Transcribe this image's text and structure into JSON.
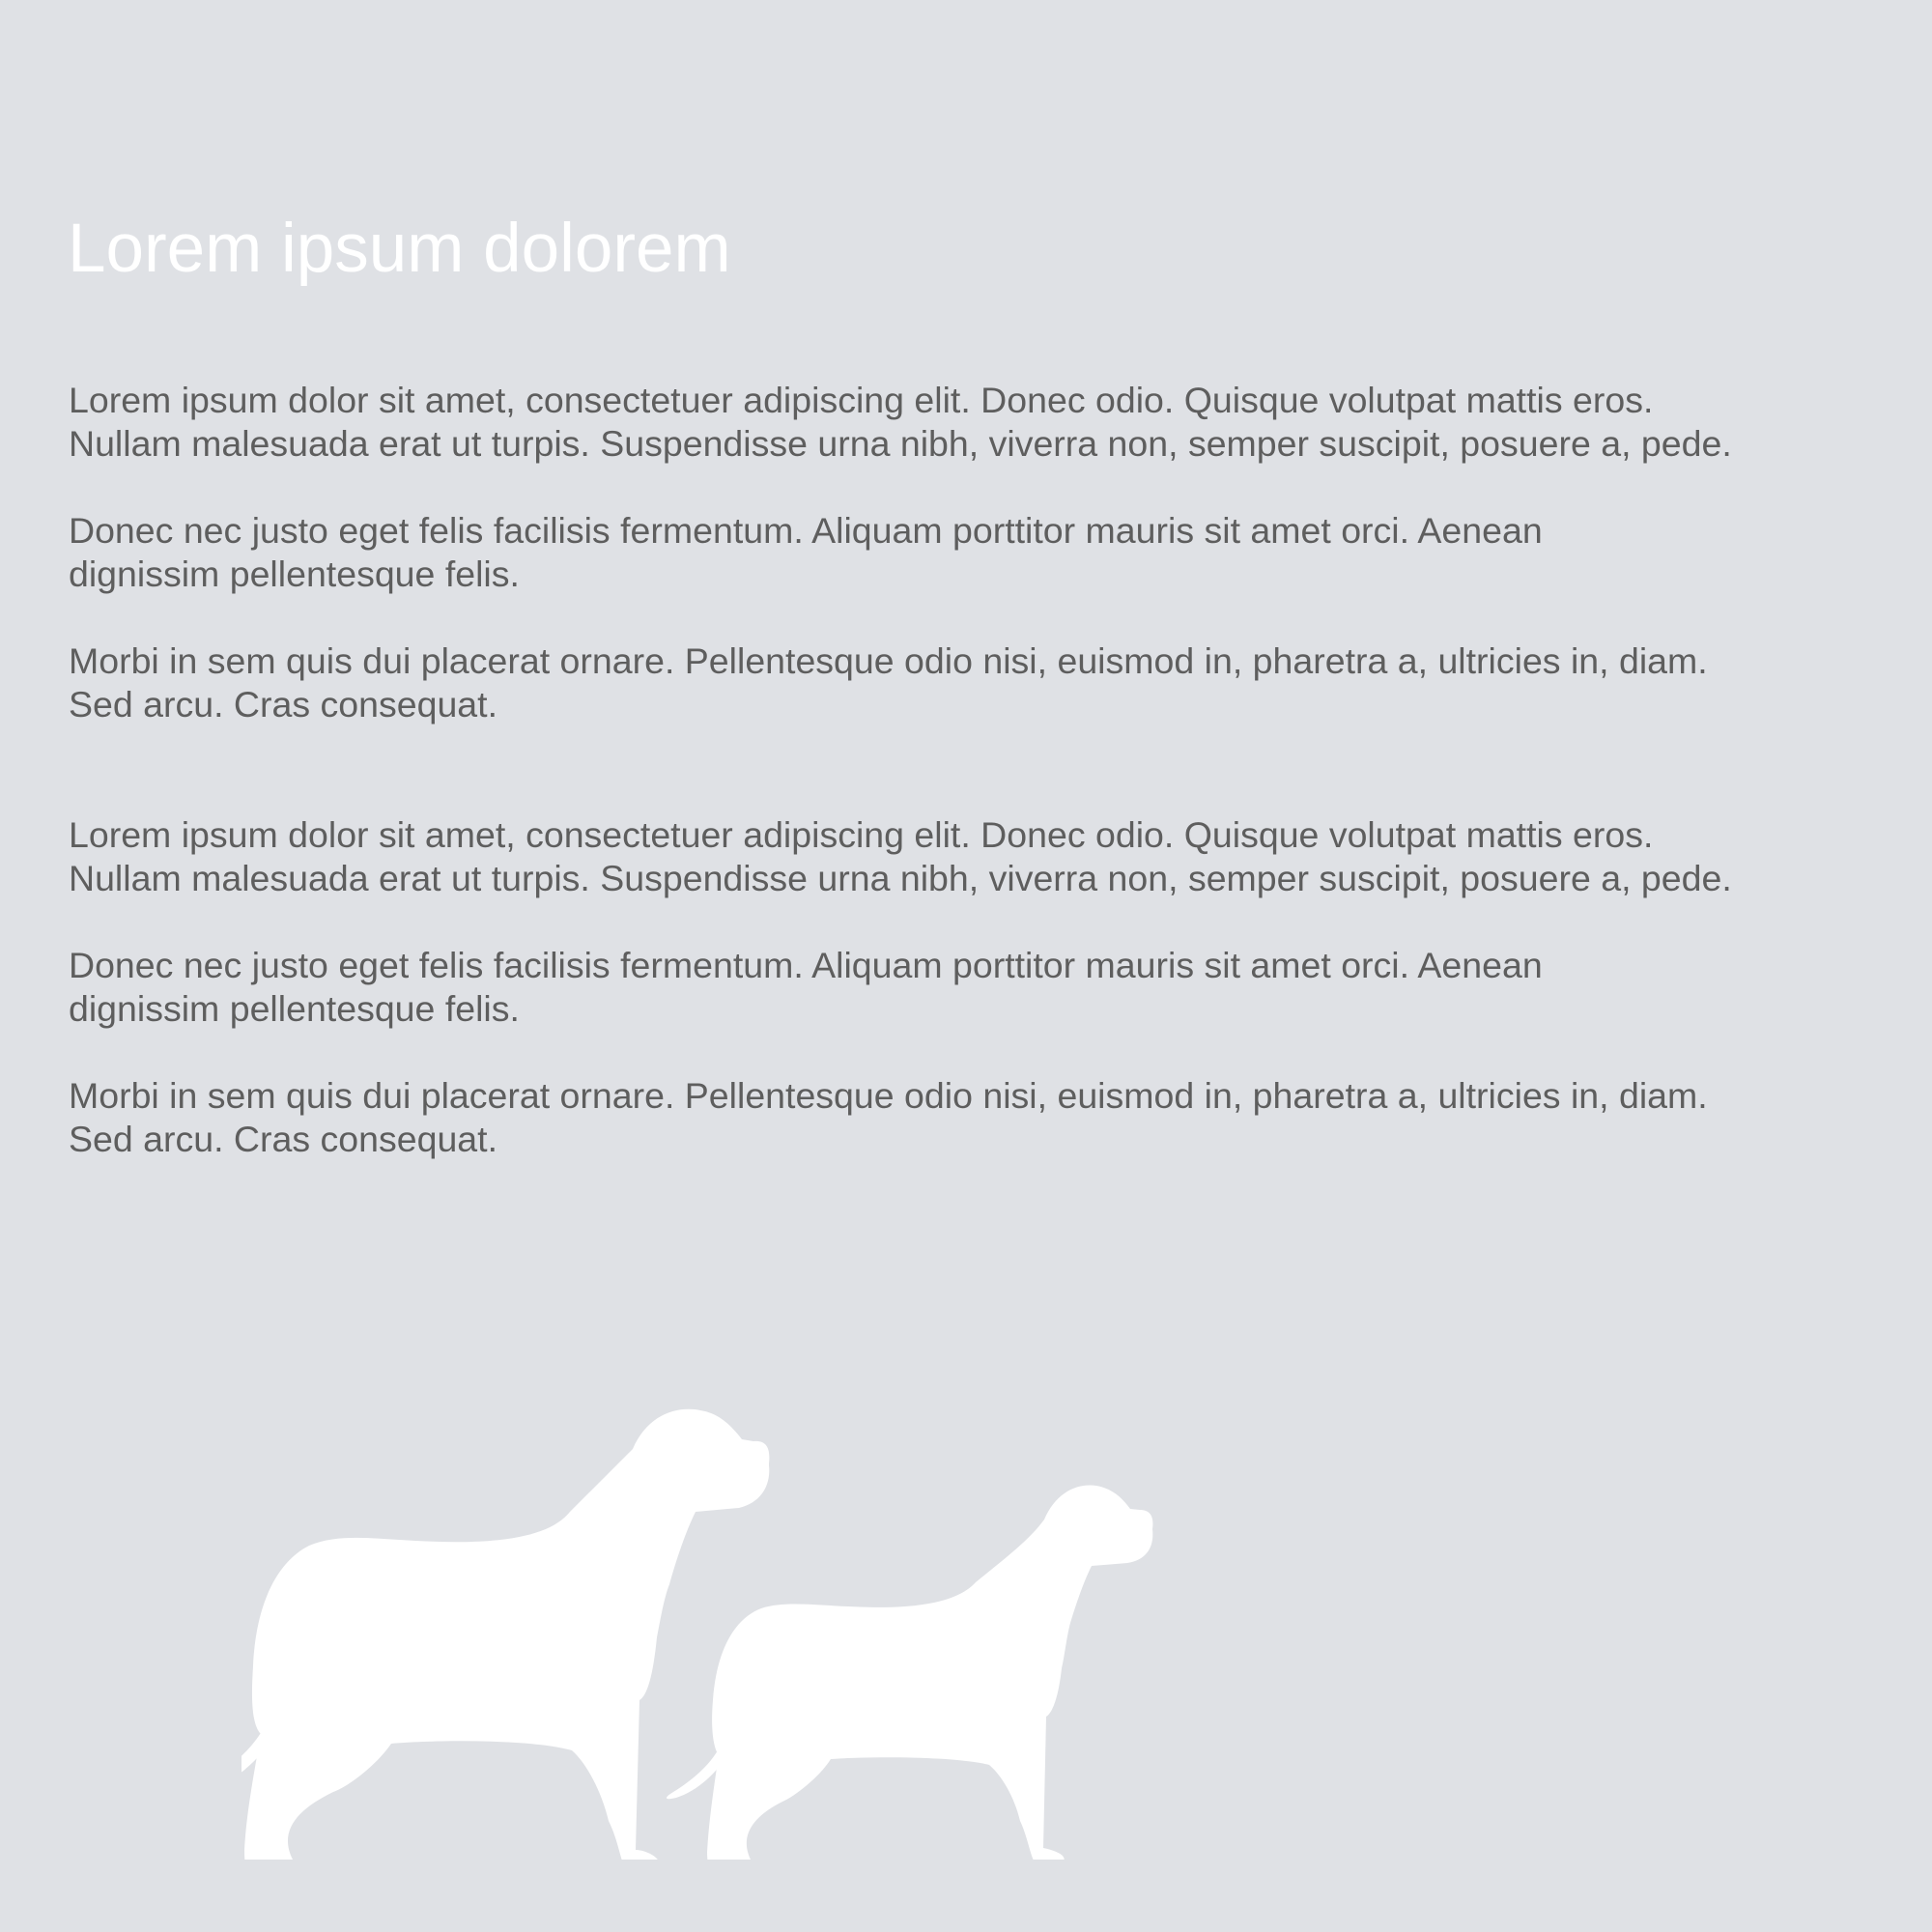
{
  "title": "Lorem ipsum dolorem",
  "sections": [
    {
      "paragraphs": [
        [
          "Lorem ipsum dolor sit amet, consectetuer adipiscing elit. Donec odio. Quisque volutpat mattis eros.",
          "Nullam malesuada erat ut turpis. Suspendisse urna nibh, viverra non, semper suscipit, posuere a, pede."
        ],
        [
          "Donec nec justo eget felis facilisis fermentum. Aliquam porttitor mauris sit amet orci. Aenean",
          "dignissim pellentesque felis."
        ],
        [
          "Morbi in sem quis dui placerat ornare. Pellentesque odio nisi, euismod in, pharetra a, ultricies in, diam.",
          "Sed arcu. Cras consequat."
        ]
      ]
    },
    {
      "paragraphs": [
        [
          "Lorem ipsum dolor sit amet, consectetuer adipiscing elit. Donec odio. Quisque volutpat mattis eros.",
          "Nullam malesuada erat ut turpis. Suspendisse urna nibh, viverra non, semper suscipit, posuere a, pede."
        ],
        [
          "Donec nec justo eget felis facilisis fermentum. Aliquam porttitor mauris sit amet orci. Aenean",
          "dignissim pellentesque felis."
        ],
        [
          "Morbi in sem quis dui placerat ornare. Pellentesque odio nisi, euismod in, pharetra a, ultricies in, diam.",
          "Sed arcu. Cras consequat."
        ]
      ]
    }
  ],
  "illustration": {
    "icons": [
      "large-dog-silhouette-icon",
      "small-dog-silhouette-icon"
    ],
    "color": "#ffffff"
  },
  "colors": {
    "background": "#dfe1e5",
    "title": "#ffffff",
    "body_text": "#5e5e5e"
  }
}
